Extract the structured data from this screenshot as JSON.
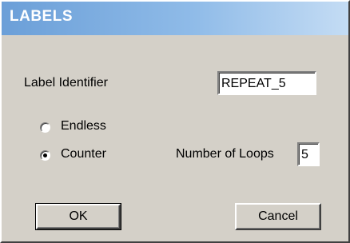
{
  "window": {
    "title": "LABELS"
  },
  "form": {
    "label_identifier_caption": "Label Identifier",
    "label_identifier_value": "REPEAT_5",
    "mode_options": [
      {
        "label": "Endless",
        "selected": false
      },
      {
        "label": "Counter",
        "selected": true
      }
    ],
    "number_of_loops_caption": "Number of Loops",
    "number_of_loops_value": "5"
  },
  "buttons": {
    "ok_label": "OK",
    "cancel_label": "Cancel"
  },
  "colors": {
    "dialog_background": "#d4d0c8",
    "titlebar_start": "#6b9fd8",
    "titlebar_end": "#c4dcf4",
    "title_text": "#ffffff"
  }
}
